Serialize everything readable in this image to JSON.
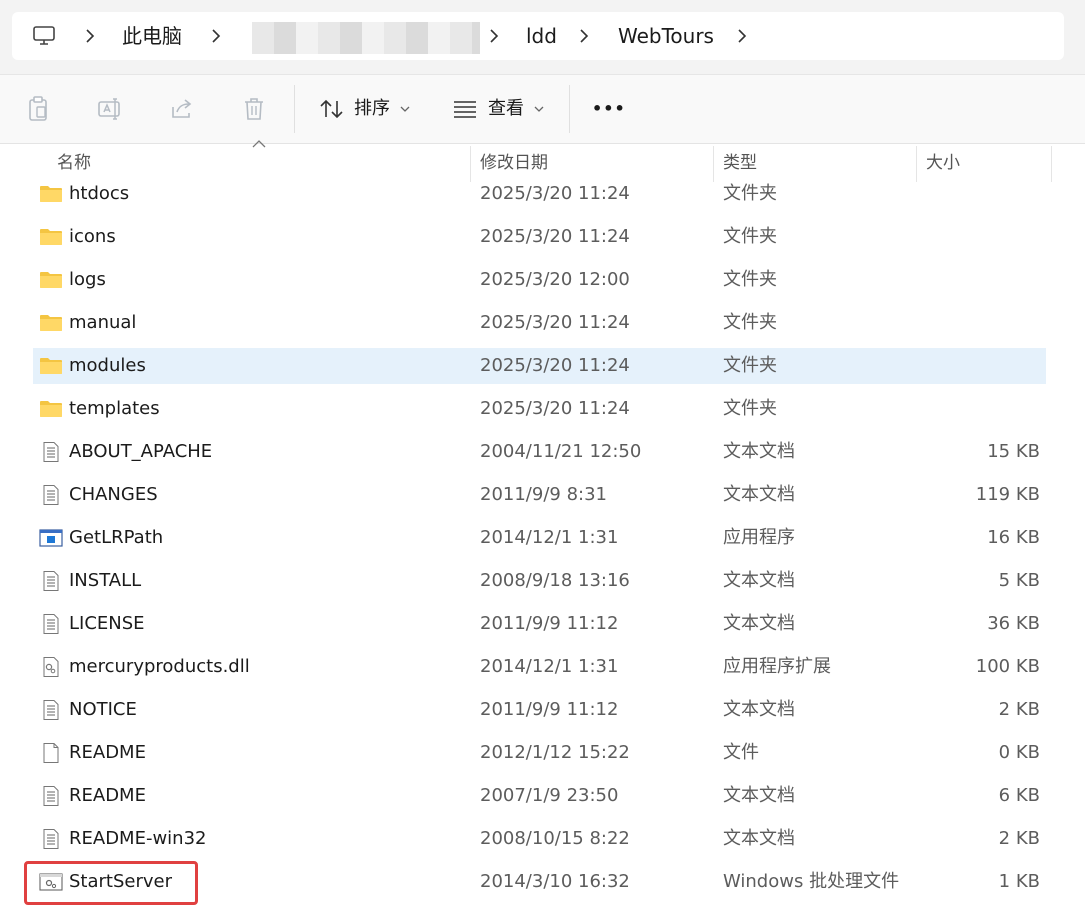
{
  "address": {
    "crumbs": [
      "此电脑",
      "ldd",
      "WebTours"
    ]
  },
  "toolbar": {
    "sort_label": "排序",
    "view_label": "查看",
    "more_label": "•••"
  },
  "columns": {
    "name": "名称",
    "modified": "修改日期",
    "type": "类型",
    "size": "大小"
  },
  "files": [
    {
      "name": "htdocs",
      "date": "2025/3/20 11:24",
      "type": "文件夹",
      "size": "",
      "icon": "folder-icon"
    },
    {
      "name": "icons",
      "date": "2025/3/20 11:24",
      "type": "文件夹",
      "size": "",
      "icon": "folder-icon"
    },
    {
      "name": "logs",
      "date": "2025/3/20 12:00",
      "type": "文件夹",
      "size": "",
      "icon": "folder-icon"
    },
    {
      "name": "manual",
      "date": "2025/3/20 11:24",
      "type": "文件夹",
      "size": "",
      "icon": "folder-icon"
    },
    {
      "name": "modules",
      "date": "2025/3/20 11:24",
      "type": "文件夹",
      "size": "",
      "icon": "folder-icon",
      "selected": true
    },
    {
      "name": "templates",
      "date": "2025/3/20 11:24",
      "type": "文件夹",
      "size": "",
      "icon": "folder-icon"
    },
    {
      "name": "ABOUT_APACHE",
      "date": "2004/11/21 12:50",
      "type": "文本文档",
      "size": "15 KB",
      "icon": "text-document-icon"
    },
    {
      "name": "CHANGES",
      "date": "2011/9/9 8:31",
      "type": "文本文档",
      "size": "119 KB",
      "icon": "text-document-icon"
    },
    {
      "name": "GetLRPath",
      "date": "2014/12/1 1:31",
      "type": "应用程序",
      "size": "16 KB",
      "icon": "application-icon"
    },
    {
      "name": "INSTALL",
      "date": "2008/9/18 13:16",
      "type": "文本文档",
      "size": "5 KB",
      "icon": "text-document-icon"
    },
    {
      "name": "LICENSE",
      "date": "2011/9/9 11:12",
      "type": "文本文档",
      "size": "36 KB",
      "icon": "text-document-icon"
    },
    {
      "name": "mercuryproducts.dll",
      "date": "2014/12/1 1:31",
      "type": "应用程序扩展",
      "size": "100 KB",
      "icon": "dll-file-icon"
    },
    {
      "name": "NOTICE",
      "date": "2011/9/9 11:12",
      "type": "文本文档",
      "size": "2 KB",
      "icon": "text-document-icon"
    },
    {
      "name": "README",
      "date": "2012/1/12 15:22",
      "type": "文件",
      "size": "0 KB",
      "icon": "blank-file-icon"
    },
    {
      "name": "README",
      "date": "2007/1/9 23:50",
      "type": "文本文档",
      "size": "6 KB",
      "icon": "text-document-icon"
    },
    {
      "name": "README-win32",
      "date": "2008/10/15 8:22",
      "type": "文本文档",
      "size": "2 KB",
      "icon": "text-document-icon"
    },
    {
      "name": "StartServer",
      "date": "2014/3/10 16:32",
      "type": "Windows 批处理文件",
      "size": "1 KB",
      "icon": "batch-file-icon"
    }
  ]
}
